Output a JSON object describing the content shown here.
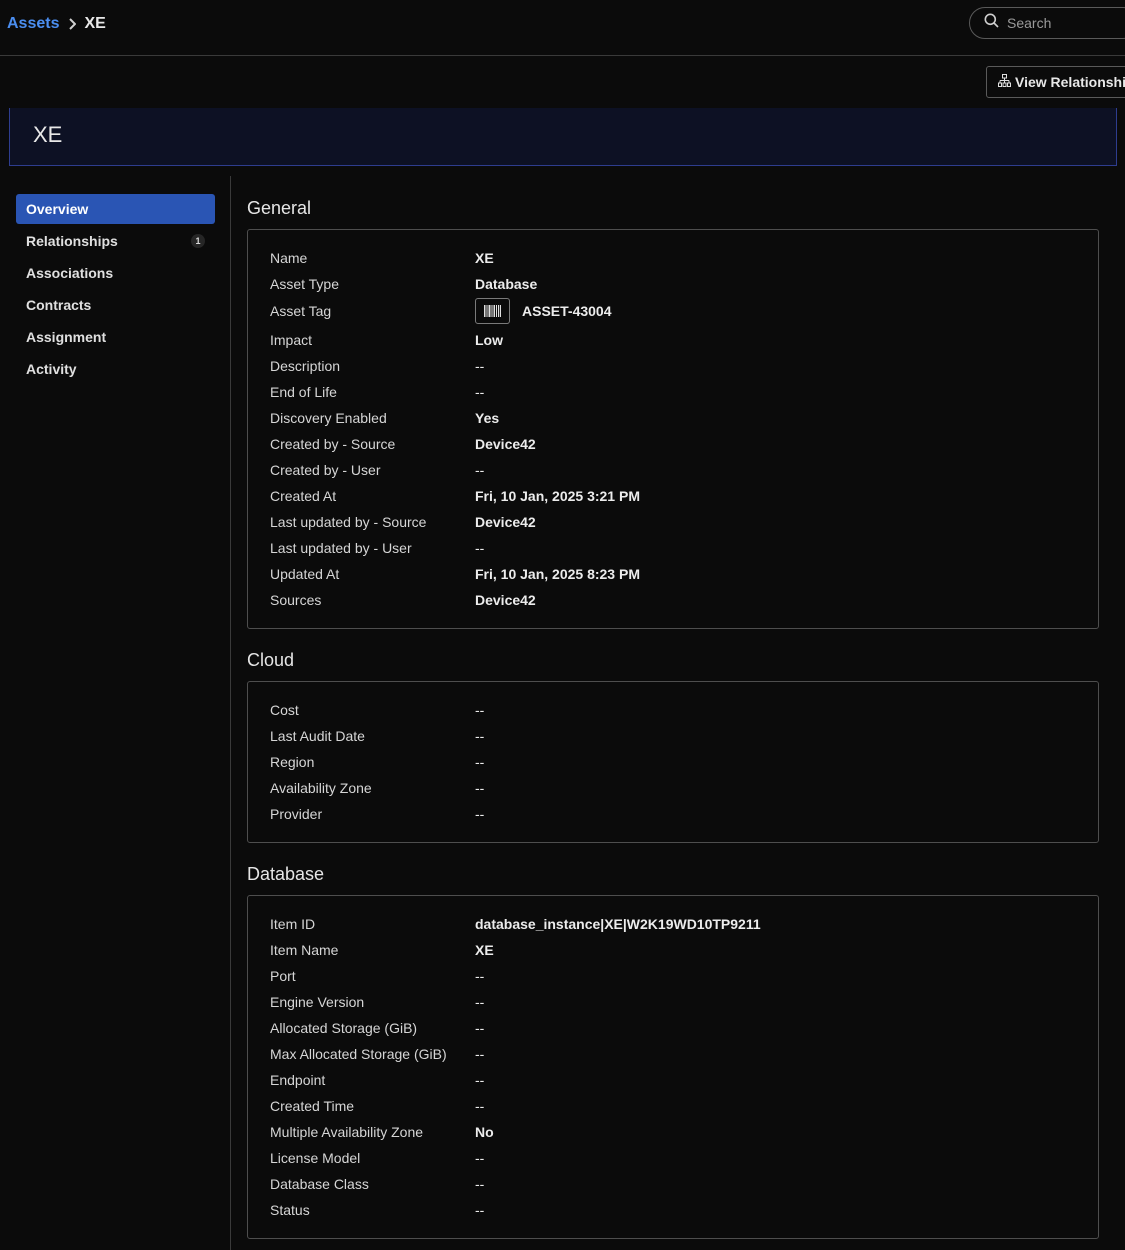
{
  "breadcrumb": {
    "root": "Assets",
    "current": "XE"
  },
  "search": {
    "placeholder": "Search"
  },
  "actions": {
    "view_relationships": "View Relationships"
  },
  "asset": {
    "title": "XE"
  },
  "sidebar": {
    "items": [
      {
        "label": "Overview",
        "active": true
      },
      {
        "label": "Relationships",
        "badge": "1"
      },
      {
        "label": "Associations"
      },
      {
        "label": "Contracts"
      },
      {
        "label": "Assignment"
      },
      {
        "label": "Activity"
      }
    ]
  },
  "general": {
    "title": "General",
    "rows": [
      {
        "label": "Name",
        "value": "XE"
      },
      {
        "label": "Asset Type",
        "value": "Database"
      },
      {
        "label": "Asset Tag",
        "value": "ASSET-43004"
      },
      {
        "label": "Impact",
        "value": "Low"
      },
      {
        "label": "Description",
        "value": "--"
      },
      {
        "label": "End of Life",
        "value": "--"
      },
      {
        "label": "Discovery Enabled",
        "value": "Yes"
      },
      {
        "label": "Created by - Source",
        "value": "Device42"
      },
      {
        "label": "Created by - User",
        "value": "--"
      },
      {
        "label": "Created At",
        "value": "Fri, 10 Jan, 2025 3:21 PM"
      },
      {
        "label": "Last updated by - Source",
        "value": "Device42"
      },
      {
        "label": "Last updated by - User",
        "value": "--"
      },
      {
        "label": "Updated At",
        "value": "Fri, 10 Jan, 2025 8:23 PM"
      },
      {
        "label": "Sources",
        "value": "Device42"
      }
    ]
  },
  "cloud": {
    "title": "Cloud",
    "rows": [
      {
        "label": "Cost",
        "value": "--"
      },
      {
        "label": "Last Audit Date",
        "value": "--"
      },
      {
        "label": "Region",
        "value": "--"
      },
      {
        "label": "Availability Zone",
        "value": "--"
      },
      {
        "label": "Provider",
        "value": "--"
      }
    ]
  },
  "database": {
    "title": "Database",
    "rows": [
      {
        "label": "Item ID",
        "value": "database_instance|XE|W2K19WD10TP9211"
      },
      {
        "label": "Item Name",
        "value": "XE"
      },
      {
        "label": "Port",
        "value": "--"
      },
      {
        "label": "Engine Version",
        "value": "--"
      },
      {
        "label": "Allocated Storage (GiB)",
        "value": "--"
      },
      {
        "label": "Max Allocated Storage (GiB)",
        "value": "--"
      },
      {
        "label": "Endpoint",
        "value": "--"
      },
      {
        "label": "Created Time",
        "value": "--"
      },
      {
        "label": "Multiple Availability Zone",
        "value": "No"
      },
      {
        "label": "License Model",
        "value": "--"
      },
      {
        "label": "Database Class",
        "value": "--"
      },
      {
        "label": "Status",
        "value": "--"
      }
    ]
  },
  "theme": {
    "accent": "#2a55b4",
    "link": "#4b8ef0",
    "hero_border": "#2e3d8f"
  }
}
